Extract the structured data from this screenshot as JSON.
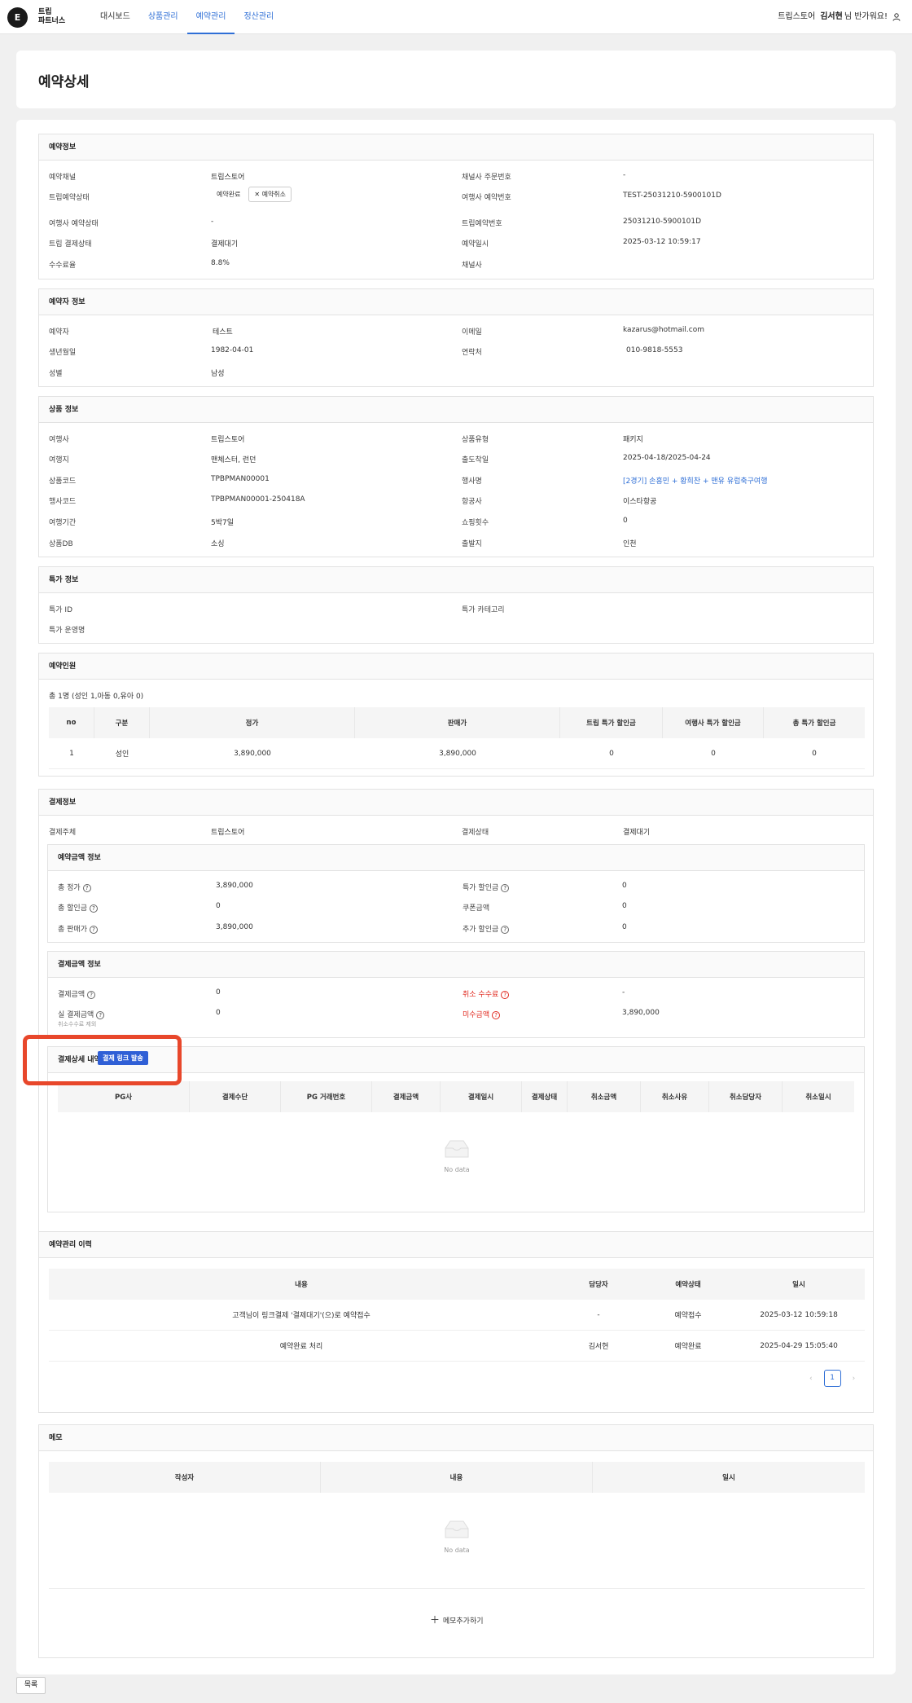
{
  "nav": {
    "logo": "E",
    "brand_line1": "트립",
    "brand_line2": "파트너스",
    "items": [
      "대시보드",
      "상품관리",
      "예약관리",
      "정산관리"
    ],
    "user_store": "트립스토어",
    "user_name": "김서현",
    "greeting": "님 반가워요!"
  },
  "page_title": "예약상세",
  "reservation": {
    "title": "예약정보",
    "channel_label": "예약채널",
    "channel": "트립스토어",
    "channel_order_label": "채널사 주문번호",
    "channel_order": "-",
    "trip_status_label": "트립예약상태",
    "trip_status": "예약완료",
    "cancel_label": "예약취소",
    "agency_res_no_label": "여행사 예약번호",
    "agency_res_no": "TEST-25031210-5900101D",
    "agency_status_label": "여행사 예약상태",
    "agency_status": "-",
    "trip_res_no_label": "트립예약번호",
    "trip_res_no": "25031210-5900101D",
    "pay_status_label": "트립 결제상태",
    "pay_status": "결제대기",
    "res_date_label": "예약일시",
    "res_date": "2025-03-12 10:59:17",
    "fee_label": "수수료율",
    "fee": "8.8%",
    "channel_co_label": "채널사"
  },
  "booker": {
    "title": "예약자 정보",
    "name_label": "예약자",
    "name": "테스트",
    "email_label": "이메일",
    "email": "kazarus@hotmail.com",
    "birth_label": "생년월일",
    "birth": "1982-04-01",
    "phone_label": "연락처",
    "phone": "010-9818-5553",
    "gender_label": "성별",
    "gender": "남성"
  },
  "product": {
    "title": "상품 정보",
    "agency_label": "여행사",
    "agency": "트립스토어",
    "type_label": "상품유형",
    "type": "패키지",
    "dest_label": "여행지",
    "dest": "맨체스터, 런던",
    "dep_date_label": "출도착일",
    "dep_date": "2025-04-18/2025-04-24",
    "code_label": "상품코드",
    "code": "TPBPMAN00001",
    "event_label": "행사명",
    "event": "[2경기] 손흥민 + 황희찬 + 맨유 유럽축구여행",
    "event_code_label": "행사코드",
    "event_code": "TPBPMAN00001-250418A",
    "airline_label": "항공사",
    "airline": "이스타항공",
    "period_label": "여행기간",
    "period": "5박7일",
    "shopping_label": "쇼핑횟수",
    "shopping": "0",
    "db_label": "상품DB",
    "db": "소싱",
    "origin_label": "출발지",
    "origin": "인천"
  },
  "special": {
    "title": "특가 정보",
    "id_label": "특가 ID",
    "category_label": "특가 카테고리",
    "operator_label": "특가 운영명"
  },
  "people": {
    "title": "예약인원",
    "summary": "총 1명 (성인 1,아동 0,유아 0)",
    "headers": [
      "no",
      "구분",
      "정가",
      "판매가",
      "트립 특가 할인금",
      "여행사 특가 할인금",
      "총 특가 할인금"
    ],
    "rows": [
      [
        "1",
        "성인",
        "3,890,000",
        "3,890,000",
        "0",
        "0",
        "0"
      ]
    ]
  },
  "payment": {
    "title": "결제정보",
    "subject_label": "결제주체",
    "subject": "트립스토어",
    "status_label": "결제상태",
    "status": "결제대기",
    "amount_info": {
      "title": "예약금액 정보",
      "list_label": "총 정가",
      "list": "3,890,000",
      "special_disc_label": "특가 할인금",
      "special_disc": "0",
      "total_disc_label": "총 할인금",
      "total_disc": "0",
      "coupon_label": "쿠폰금액",
      "coupon": "0",
      "total_sale_label": "총 판매가",
      "total_sale": "3,890,000",
      "extra_disc_label": "추가 할인금",
      "extra_disc": "0"
    },
    "pay_info": {
      "title": "결제금액 정보",
      "paid_label": "결제금액",
      "paid": "0",
      "cancel_fee_label": "취소 수수료",
      "cancel_fee": "-",
      "actual_label": "실 결제금액",
      "actual": "0",
      "actual_note": "취소수수료 제외",
      "unpaid_label": "미수금액",
      "unpaid": "3,890,000"
    },
    "detail": {
      "title": "결제상세 내역",
      "send_link": "결제 링크 발송",
      "headers": [
        "PG사",
        "결제수단",
        "PG 거래번호",
        "결제금액",
        "결제일시",
        "결제상태",
        "취소금액",
        "취소사유",
        "취소담당자",
        "취소일시"
      ],
      "nodata": "No data"
    }
  },
  "history": {
    "title": "예약관리 이력",
    "headers": [
      "내용",
      "담당자",
      "예약상태",
      "일시"
    ],
    "rows": [
      [
        "고객님이 링크결제 '결제대기'(으)로 예약접수",
        "-",
        "예약접수",
        "2025-03-12 10:59:18"
      ],
      [
        "예약완료 처리",
        "김서현",
        "예약완료",
        "2025-04-29 15:05:40"
      ]
    ],
    "page": "1",
    "prev": "‹",
    "next": "›"
  },
  "memo": {
    "title": "메모",
    "headers": [
      "작성자",
      "내용",
      "일시"
    ],
    "nodata": "No data",
    "add": "메모추가하기"
  },
  "back": "목록"
}
